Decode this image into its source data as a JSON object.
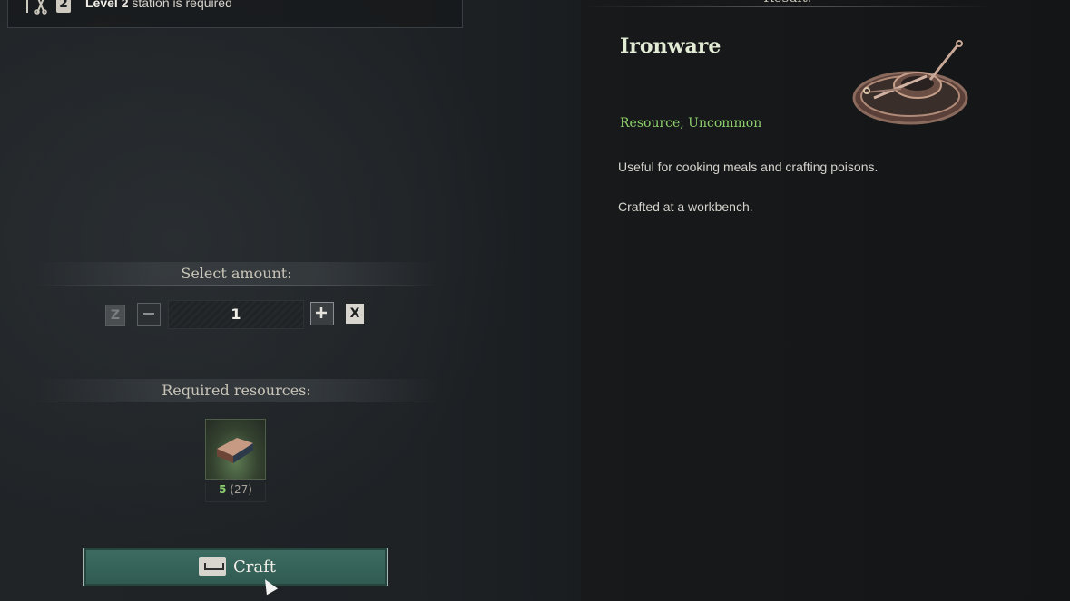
{
  "top_bar": {
    "level_number": "2",
    "level_label": "Level 2",
    "requirement_text": " station is required"
  },
  "amount": {
    "header": "Select amount:",
    "decrease_key": "Z",
    "value": "1",
    "increase_key": "X"
  },
  "resources": {
    "header": "Required resources:",
    "items": [
      {
        "icon": "iron-ingot-icon",
        "have": "5",
        "total": "(27)"
      }
    ]
  },
  "craft": {
    "label": "Craft"
  },
  "result": {
    "header": "Result:",
    "name": "Ironware",
    "type": "Resource, Uncommon",
    "description": [
      "Useful for cooking meals and crafting poisons.",
      "Crafted at a workbench."
    ]
  },
  "colors": {
    "accent_green": "#8ecf6d",
    "craft_button": "#3d6c62",
    "item_name": "#e2ecd4"
  }
}
